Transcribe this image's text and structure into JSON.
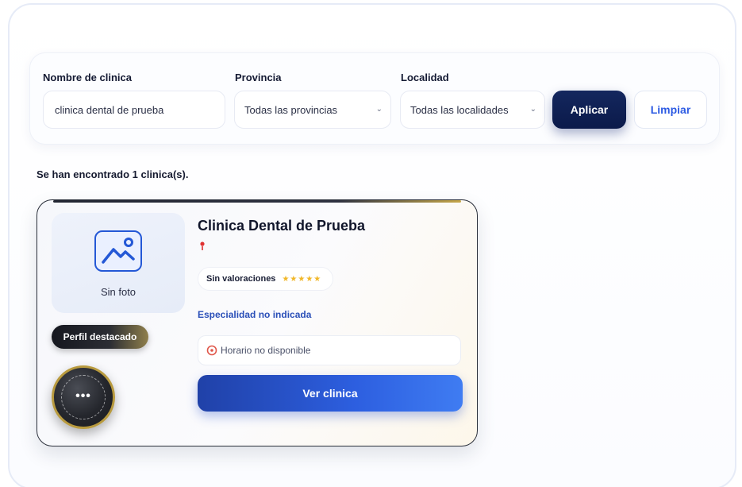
{
  "filters": {
    "name_label": "Nombre de clinica",
    "name_value": "clinica dental de prueba",
    "province_label": "Provincia",
    "province_value": "Todas las provincias",
    "locality_label": "Localidad",
    "locality_value": "Todas las localidades",
    "apply_label": "Aplicar",
    "clear_label": "Limpiar"
  },
  "results": {
    "count_text": "Se han encontrado 1 clinica(s)."
  },
  "card": {
    "no_photo_label": "Sin foto",
    "featured_label": "Perfil destacado",
    "menu_dots": "•••",
    "clinic_name": "Clinica Dental de Prueba",
    "rating_label": "Sin valoraciones",
    "stars": "★★★★★",
    "specialty": "Especialidad no indicada",
    "hours": "Horario no disponible",
    "view_label": "Ver clinica"
  },
  "colors": {
    "accent_blue": "#2d5fe0",
    "navy": "#0b1a4a",
    "gold": "#b89a3e",
    "star": "#f1b728"
  }
}
